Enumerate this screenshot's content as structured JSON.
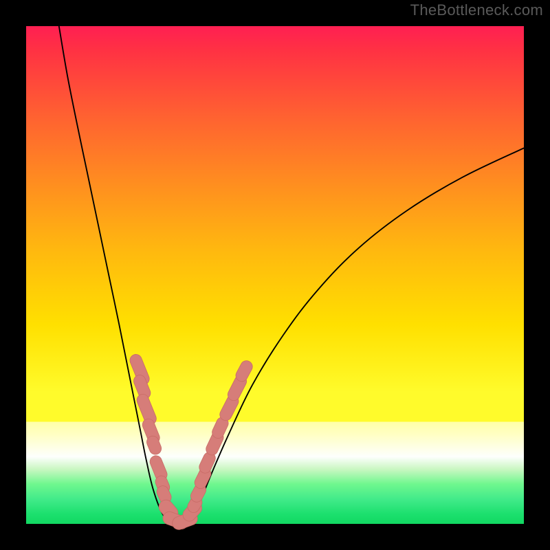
{
  "watermark": "TheBottleneck.com",
  "colors": {
    "background": "#000000",
    "curve": "#000000",
    "marker_fill": "#d67d79",
    "marker_stroke": "#c86c66"
  },
  "chart_data": {
    "type": "line",
    "title": "",
    "xlabel": "",
    "ylabel": "",
    "xlim": [
      0,
      100
    ],
    "ylim": [
      0,
      100
    ],
    "series": [
      {
        "name": "left-branch",
        "x": [
          6.6,
          8.3,
          10.3,
          12.4,
          14.5,
          16.6,
          18.7,
          20.7,
          22.1,
          23.1,
          24.1,
          25.5,
          27.3,
          29.0,
          30.7
        ],
        "y": [
          100,
          90,
          80,
          70,
          60,
          50,
          40,
          30,
          23,
          18,
          13,
          7,
          2.2,
          0.4,
          0
        ]
      },
      {
        "name": "right-branch",
        "x": [
          30.7,
          32.5,
          33.8,
          35.2,
          37.2,
          40.7,
          45.5,
          51.7,
          58.6,
          66.9,
          76.6,
          87.6,
          100
        ],
        "y": [
          0,
          0.5,
          2,
          5,
          10,
          18,
          28,
          38,
          47,
          55.5,
          63,
          69.6,
          75.5
        ]
      }
    ],
    "markers": {
      "name": "highlighted-points",
      "points": [
        {
          "x": 22.8,
          "y": 31.0,
          "rx": 1.2,
          "ry": 3.2,
          "rot": -22
        },
        {
          "x": 23.3,
          "y": 27.5,
          "rx": 1.2,
          "ry": 2.5,
          "rot": -22
        },
        {
          "x": 24.2,
          "y": 23.0,
          "rx": 1.2,
          "ry": 3.2,
          "rot": -22
        },
        {
          "x": 25.1,
          "y": 18.6,
          "rx": 1.2,
          "ry": 2.6,
          "rot": -22
        },
        {
          "x": 25.7,
          "y": 15.8,
          "rx": 1.2,
          "ry": 1.9,
          "rot": -22
        },
        {
          "x": 26.6,
          "y": 11.2,
          "rx": 1.2,
          "ry": 2.6,
          "rot": -22
        },
        {
          "x": 27.4,
          "y": 7.9,
          "rx": 1.2,
          "ry": 1.8,
          "rot": -22
        },
        {
          "x": 27.7,
          "y": 5.9,
          "rx": 1.2,
          "ry": 1.8,
          "rot": -25
        },
        {
          "x": 28.6,
          "y": 2.8,
          "rx": 1.4,
          "ry": 2.2,
          "rot": -40
        },
        {
          "x": 30.0,
          "y": 0.7,
          "rx": 1.3,
          "ry": 2.6,
          "rot": -70
        },
        {
          "x": 31.9,
          "y": 0.6,
          "rx": 1.3,
          "ry": 2.6,
          "rot": 70
        },
        {
          "x": 33.4,
          "y": 2.5,
          "rx": 1.3,
          "ry": 2.2,
          "rot": 42
        },
        {
          "x": 33.9,
          "y": 3.9,
          "rx": 1.2,
          "ry": 1.7,
          "rot": 30
        },
        {
          "x": 34.6,
          "y": 6.2,
          "rx": 1.2,
          "ry": 1.9,
          "rot": 28
        },
        {
          "x": 35.5,
          "y": 9.2,
          "rx": 1.2,
          "ry": 2.2,
          "rot": 26
        },
        {
          "x": 36.4,
          "y": 12.3,
          "rx": 1.2,
          "ry": 2.2,
          "rot": 25
        },
        {
          "x": 37.9,
          "y": 16.2,
          "rx": 1.2,
          "ry": 2.5,
          "rot": 25
        },
        {
          "x": 39.0,
          "y": 19.3,
          "rx": 1.2,
          "ry": 2.2,
          "rot": 25
        },
        {
          "x": 40.8,
          "y": 23.3,
          "rx": 1.2,
          "ry": 2.7,
          "rot": 27
        },
        {
          "x": 42.4,
          "y": 27.3,
          "rx": 1.2,
          "ry": 2.7,
          "rot": 27
        },
        {
          "x": 43.8,
          "y": 30.7,
          "rx": 1.2,
          "ry": 2.2,
          "rot": 28
        }
      ]
    }
  }
}
